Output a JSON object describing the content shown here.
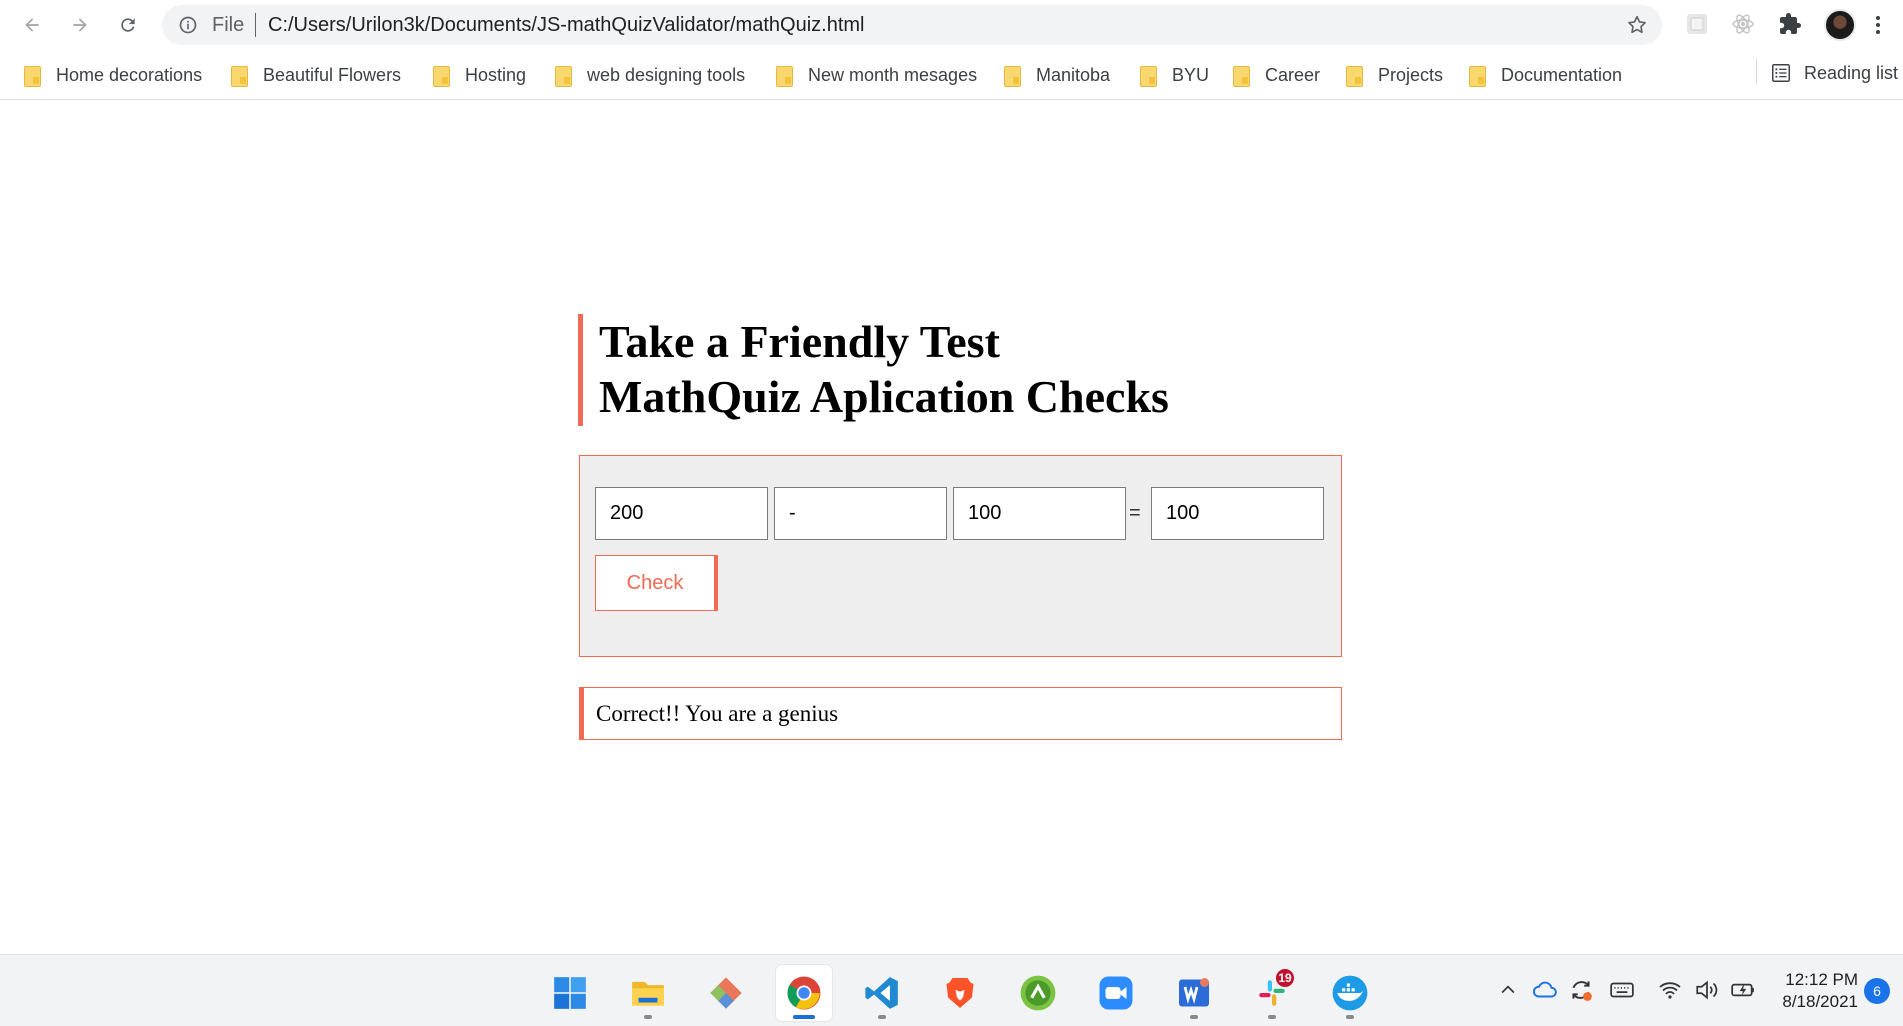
{
  "browser": {
    "scheme_label": "File",
    "url": "C:/Users/Urilon3k/Documents/JS-mathQuizValidator/mathQuiz.html",
    "icons": [
      "back-arrow-icon",
      "forward-arrow-icon",
      "reload-icon",
      "info-icon",
      "star-icon",
      "extension-icon",
      "react-icon",
      "puzzle-icon",
      "kebab-menu-icon"
    ]
  },
  "bookmarks": {
    "items": [
      {
        "label": "Home decorations"
      },
      {
        "label": "Beautiful Flowers"
      },
      {
        "label": "Hosting"
      },
      {
        "label": "web designing tools"
      },
      {
        "label": "New month mesages"
      },
      {
        "label": "Manitoba"
      },
      {
        "label": "BYU"
      },
      {
        "label": "Career"
      },
      {
        "label": "Projects"
      },
      {
        "label": "Documentation"
      }
    ],
    "reading_list": "Reading list"
  },
  "page": {
    "title_line1": "Take a Friendly Test",
    "title_line2": "MathQuiz Aplication Checks",
    "quiz": {
      "operand1": "200",
      "operator": "-",
      "operand2": "100",
      "equals": "=",
      "answer": "100",
      "check_label": "Check"
    },
    "result": "Correct!! You are a genius",
    "accent_color": "#f06a55"
  },
  "taskbar": {
    "apps": [
      "windows-start-icon",
      "file-explorer-icon",
      "git-icon",
      "chrome-icon",
      "vscode-icon",
      "brave-icon",
      "tradingview-icon",
      "zoom-icon",
      "word-icon",
      "slack-icon",
      "docker-icon"
    ],
    "slack_badge": "19",
    "time": "12:12 PM",
    "date": "8/18/2021",
    "notification_count": "6"
  }
}
